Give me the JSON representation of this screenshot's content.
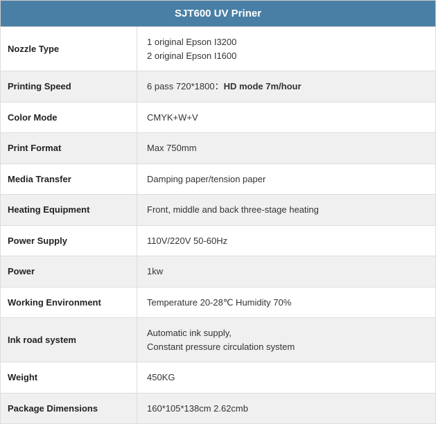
{
  "title": "SJT600 UV Priner",
  "rows": [
    {
      "label": "Nozzle Type",
      "value": "1 original Epson I3200\n2 original Epson I1600",
      "bold": false,
      "rowType": "odd"
    },
    {
      "label": "Printing Speed",
      "valuePlain": "6 pass 720*1800：",
      "valueBold": "HD mode 7m/hour",
      "bold": true,
      "rowType": "even"
    },
    {
      "label": "Color Mode",
      "value": "CMYK+W+V",
      "bold": false,
      "rowType": "odd"
    },
    {
      "label": "Print Format",
      "value": "Max 750mm",
      "bold": false,
      "rowType": "even"
    },
    {
      "label": "Media Transfer",
      "value": "Damping paper/tension paper",
      "bold": false,
      "rowType": "odd"
    },
    {
      "label": "Heating Equipment",
      "value": "Front, middle and back three-stage heating",
      "bold": false,
      "rowType": "even"
    },
    {
      "label": "Power Supply",
      "value": "110V/220V 50-60Hz",
      "bold": false,
      "rowType": "odd"
    },
    {
      "label": "Power",
      "value": "1kw",
      "bold": false,
      "rowType": "even"
    },
    {
      "label": "Working Environment",
      "value": "Temperature 20-28℃ Humidity 70%",
      "bold": false,
      "rowType": "odd"
    },
    {
      "label": "Ink road system",
      "value": "Automatic ink supply,\nConstant pressure circulation system",
      "bold": false,
      "rowType": "even"
    },
    {
      "label": "Weight",
      "value": "450KG",
      "bold": false,
      "rowType": "odd"
    },
    {
      "label": "Package Dimensions",
      "value": "160*105*138cm 2.62cmb",
      "bold": false,
      "rowType": "even"
    }
  ],
  "colors": {
    "header_bg": "#4a7fa5",
    "even_bg": "#f0f0f0",
    "odd_bg": "#ffffff"
  }
}
